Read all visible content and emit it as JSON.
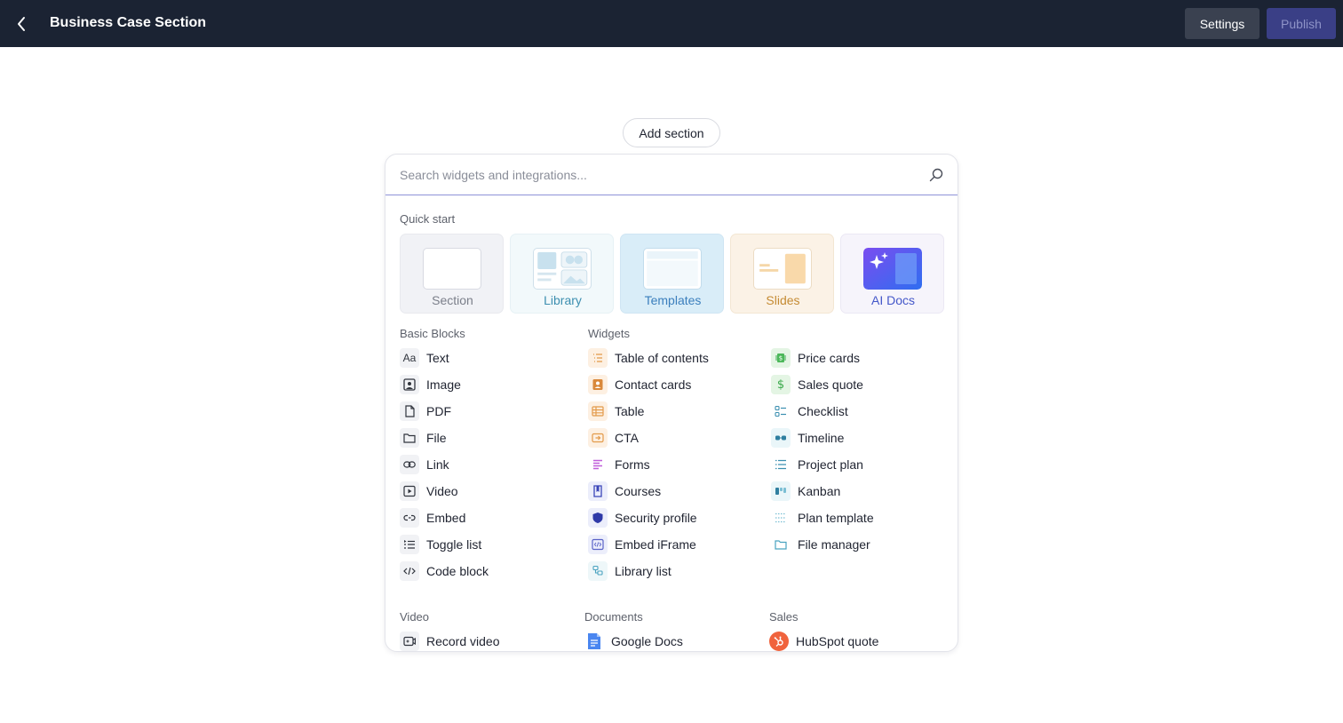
{
  "header": {
    "title": "Business Case Section",
    "settings_label": "Settings",
    "publish_label": "Publish"
  },
  "add_section_label": "Add section",
  "search": {
    "placeholder": "Search widgets and integrations..."
  },
  "quick_start": {
    "title": "Quick start",
    "cards": [
      {
        "label": "Section"
      },
      {
        "label": "Library"
      },
      {
        "label": "Templates"
      },
      {
        "label": "Slides"
      },
      {
        "label": "AI Docs"
      }
    ]
  },
  "basic_blocks": {
    "title": "Basic Blocks",
    "items": [
      {
        "label": "Text",
        "icon": "text-icon"
      },
      {
        "label": "Image",
        "icon": "image-icon"
      },
      {
        "label": "PDF",
        "icon": "pdf-icon"
      },
      {
        "label": "File",
        "icon": "folder-icon"
      },
      {
        "label": "Link",
        "icon": "link-icon"
      },
      {
        "label": "Video",
        "icon": "video-icon"
      },
      {
        "label": "Embed",
        "icon": "embed-icon"
      },
      {
        "label": "Toggle list",
        "icon": "toggle-list-icon"
      },
      {
        "label": "Code block",
        "icon": "code-icon"
      }
    ]
  },
  "widgets": {
    "title": "Widgets",
    "col1": [
      {
        "label": "Table of contents",
        "icon": "toc-icon"
      },
      {
        "label": "Contact cards",
        "icon": "contact-card-icon"
      },
      {
        "label": "Table",
        "icon": "table-icon"
      },
      {
        "label": "CTA",
        "icon": "cta-icon"
      },
      {
        "label": "Forms",
        "icon": "forms-icon"
      },
      {
        "label": "Courses",
        "icon": "courses-icon"
      },
      {
        "label": "Security profile",
        "icon": "shield-icon"
      },
      {
        "label": "Embed iFrame",
        "icon": "iframe-icon"
      },
      {
        "label": "Library list",
        "icon": "library-list-icon"
      }
    ],
    "col2": [
      {
        "label": "Price cards",
        "icon": "price-card-icon"
      },
      {
        "label": "Sales quote",
        "icon": "dollar-icon"
      },
      {
        "label": "Checklist",
        "icon": "checklist-icon"
      },
      {
        "label": "Timeline",
        "icon": "timeline-icon"
      },
      {
        "label": "Project plan",
        "icon": "project-plan-icon"
      },
      {
        "label": "Kanban",
        "icon": "kanban-icon"
      },
      {
        "label": "Plan template",
        "icon": "plan-template-icon"
      },
      {
        "label": "File manager",
        "icon": "file-manager-icon"
      }
    ]
  },
  "video": {
    "title": "Video",
    "items": [
      {
        "label": "Record video",
        "icon": "record-video-icon"
      }
    ]
  },
  "documents": {
    "title": "Documents",
    "items": [
      {
        "label": "Google Docs",
        "icon": "google-docs-icon"
      }
    ]
  },
  "sales": {
    "title": "Sales",
    "items": [
      {
        "label": "HubSpot quote",
        "icon": "hubspot-icon"
      }
    ]
  },
  "colors": {
    "topbar": "#1b2333",
    "accent": "#3a3f86",
    "search_underline": "#8f93d8"
  }
}
